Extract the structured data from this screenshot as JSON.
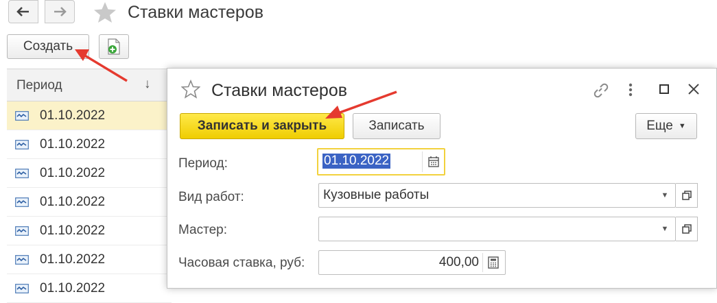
{
  "background_window": {
    "title": "Ставки мастеров",
    "create_label": "Создать",
    "column_header": "Период",
    "sort_glyph": "↓",
    "rows": [
      "01.10.2022",
      "01.10.2022",
      "01.10.2022",
      "01.10.2022",
      "01.10.2022",
      "01.10.2022",
      "01.10.2022"
    ],
    "icons": {
      "back": "arrow-left-icon",
      "forward": "arrow-right-icon",
      "favorite": "star-icon",
      "add": "add-document-icon",
      "row": "register-record-icon"
    }
  },
  "dialog": {
    "title": "Ставки мастеров",
    "save_close_label": "Записать и закрыть",
    "save_label": "Записать",
    "more_label": "Еще",
    "fields": {
      "period_label": "Период:",
      "period_value": "01.10.2022",
      "work_type_label": "Вид работ:",
      "work_type_value": "Кузовные работы",
      "master_label": "Мастер:",
      "master_value": "",
      "rate_label": "Часовая ставка, руб:",
      "rate_value": "400,00"
    },
    "icons": {
      "favorite": "star-icon",
      "link": "link-icon",
      "more": "more-vertical-icon",
      "maximize": "maximize-icon",
      "close": "close-icon",
      "calendar": "calendar-icon",
      "calculator": "calculator-icon",
      "open": "open-form-icon",
      "dropdown": "chevron-down-icon"
    }
  },
  "colors": {
    "accent_yellow": "#f5d90a",
    "selection_row": "#fbf2c9",
    "annotation_arrow": "#e53a2f",
    "period_highlight": "#3b63c4"
  }
}
